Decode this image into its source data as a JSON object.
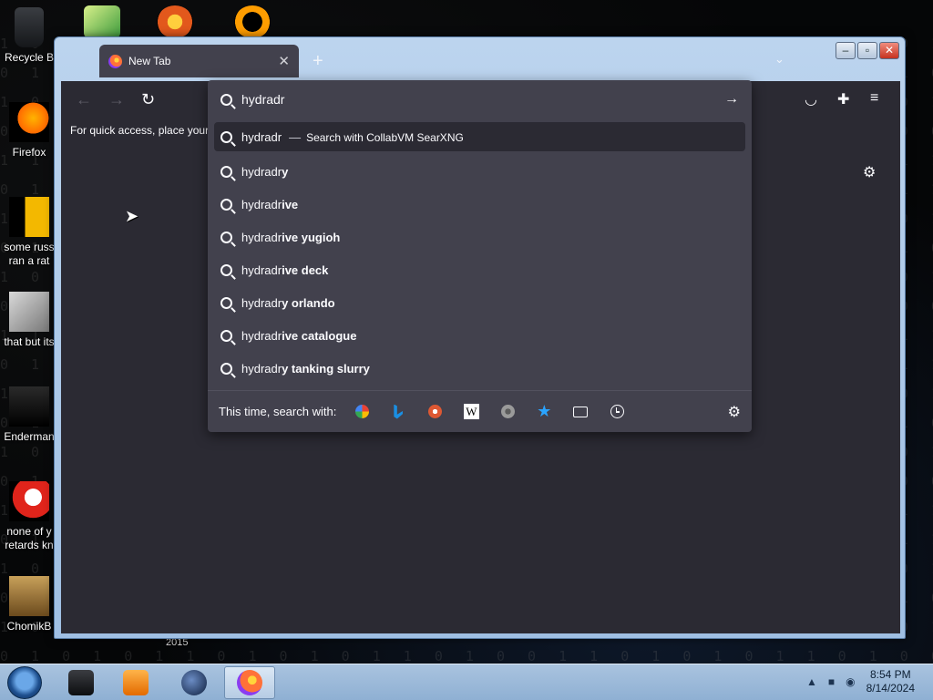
{
  "desktop": {
    "icons": [
      {
        "label": "Recycle B"
      },
      {
        "label": "Firefox"
      },
      {
        "label": "some russ ran a rat"
      },
      {
        "label": "that but its"
      },
      {
        "label": "Enderman"
      },
      {
        "label": "none of y retards kn"
      },
      {
        "label": "ChomikB"
      }
    ],
    "extra_label": "2015"
  },
  "browser": {
    "tab_title": "New Tab",
    "tab_close": "✕",
    "new_tab": "+",
    "tab_list": "⌄",
    "bookmarks_hint": "For quick access, place your b",
    "urlbar": {
      "value": "hydradr",
      "go": "→"
    },
    "suggestions": [
      {
        "typed": "hydradr",
        "completion": "",
        "engine": "Search with CollabVM SearXNG"
      },
      {
        "typed": "hydradr",
        "completion": "y"
      },
      {
        "typed": "hydradr",
        "completion": "ive"
      },
      {
        "typed": "hydradr",
        "completion": "ive yugioh"
      },
      {
        "typed": "hydradr",
        "completion": "ive deck"
      },
      {
        "typed": "hydradr",
        "completion": "y orlando"
      },
      {
        "typed": "hydradr",
        "completion": "ive catalogue"
      },
      {
        "typed": "hydradr",
        "completion": "y tanking slurry"
      }
    ],
    "separator": "—",
    "oneoff_label": "This time, search with:",
    "oneoff_engines": [
      {
        "name": "google-icon",
        "color": "#4285f4"
      },
      {
        "name": "bing-icon",
        "color": "#1a8fe3"
      },
      {
        "name": "duckduckgo-icon",
        "color": "#de5833"
      },
      {
        "name": "wikipedia-icon",
        "color": "#ffffff"
      },
      {
        "name": "searxng-icon",
        "color": "#9a9a9a"
      },
      {
        "name": "bookmarks-icon",
        "color": "#2aa4ff"
      },
      {
        "name": "tabs-icon",
        "color": "#fbfbfe"
      },
      {
        "name": "history-icon",
        "color": "#fbfbfe"
      }
    ]
  },
  "taskbar": {
    "time": "8:54 PM",
    "date": "8/14/2024"
  },
  "colors": {
    "toolbar": "#2b2a33",
    "popup": "#42414d",
    "text": "#fbfbfe"
  }
}
